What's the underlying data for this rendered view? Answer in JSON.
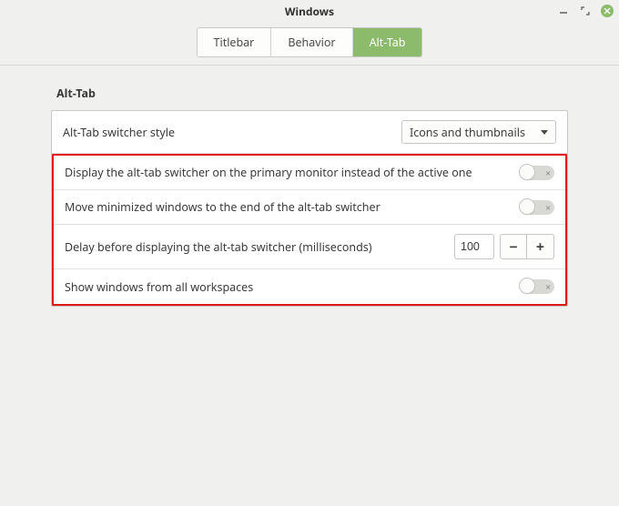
{
  "window": {
    "title": "Windows"
  },
  "tabs": {
    "titlebar": "Titlebar",
    "behavior": "Behavior",
    "alttab": "Alt-Tab"
  },
  "section": {
    "heading": "Alt-Tab"
  },
  "rows": {
    "style_label": "Alt-Tab switcher style",
    "style_value": "Icons and thumbnails",
    "primary_monitor_label": "Display the alt-tab switcher on the primary monitor instead of the active one",
    "primary_monitor_on": false,
    "move_minimized_label": "Move minimized windows to the end of the alt-tab switcher",
    "move_minimized_on": false,
    "delay_label": "Delay before displaying the alt-tab switcher (milliseconds)",
    "delay_value": "100",
    "all_workspaces_label": "Show windows from all workspaces",
    "all_workspaces_on": false
  },
  "glyphs": {
    "minus": "−",
    "plus": "+",
    "x": "×"
  }
}
